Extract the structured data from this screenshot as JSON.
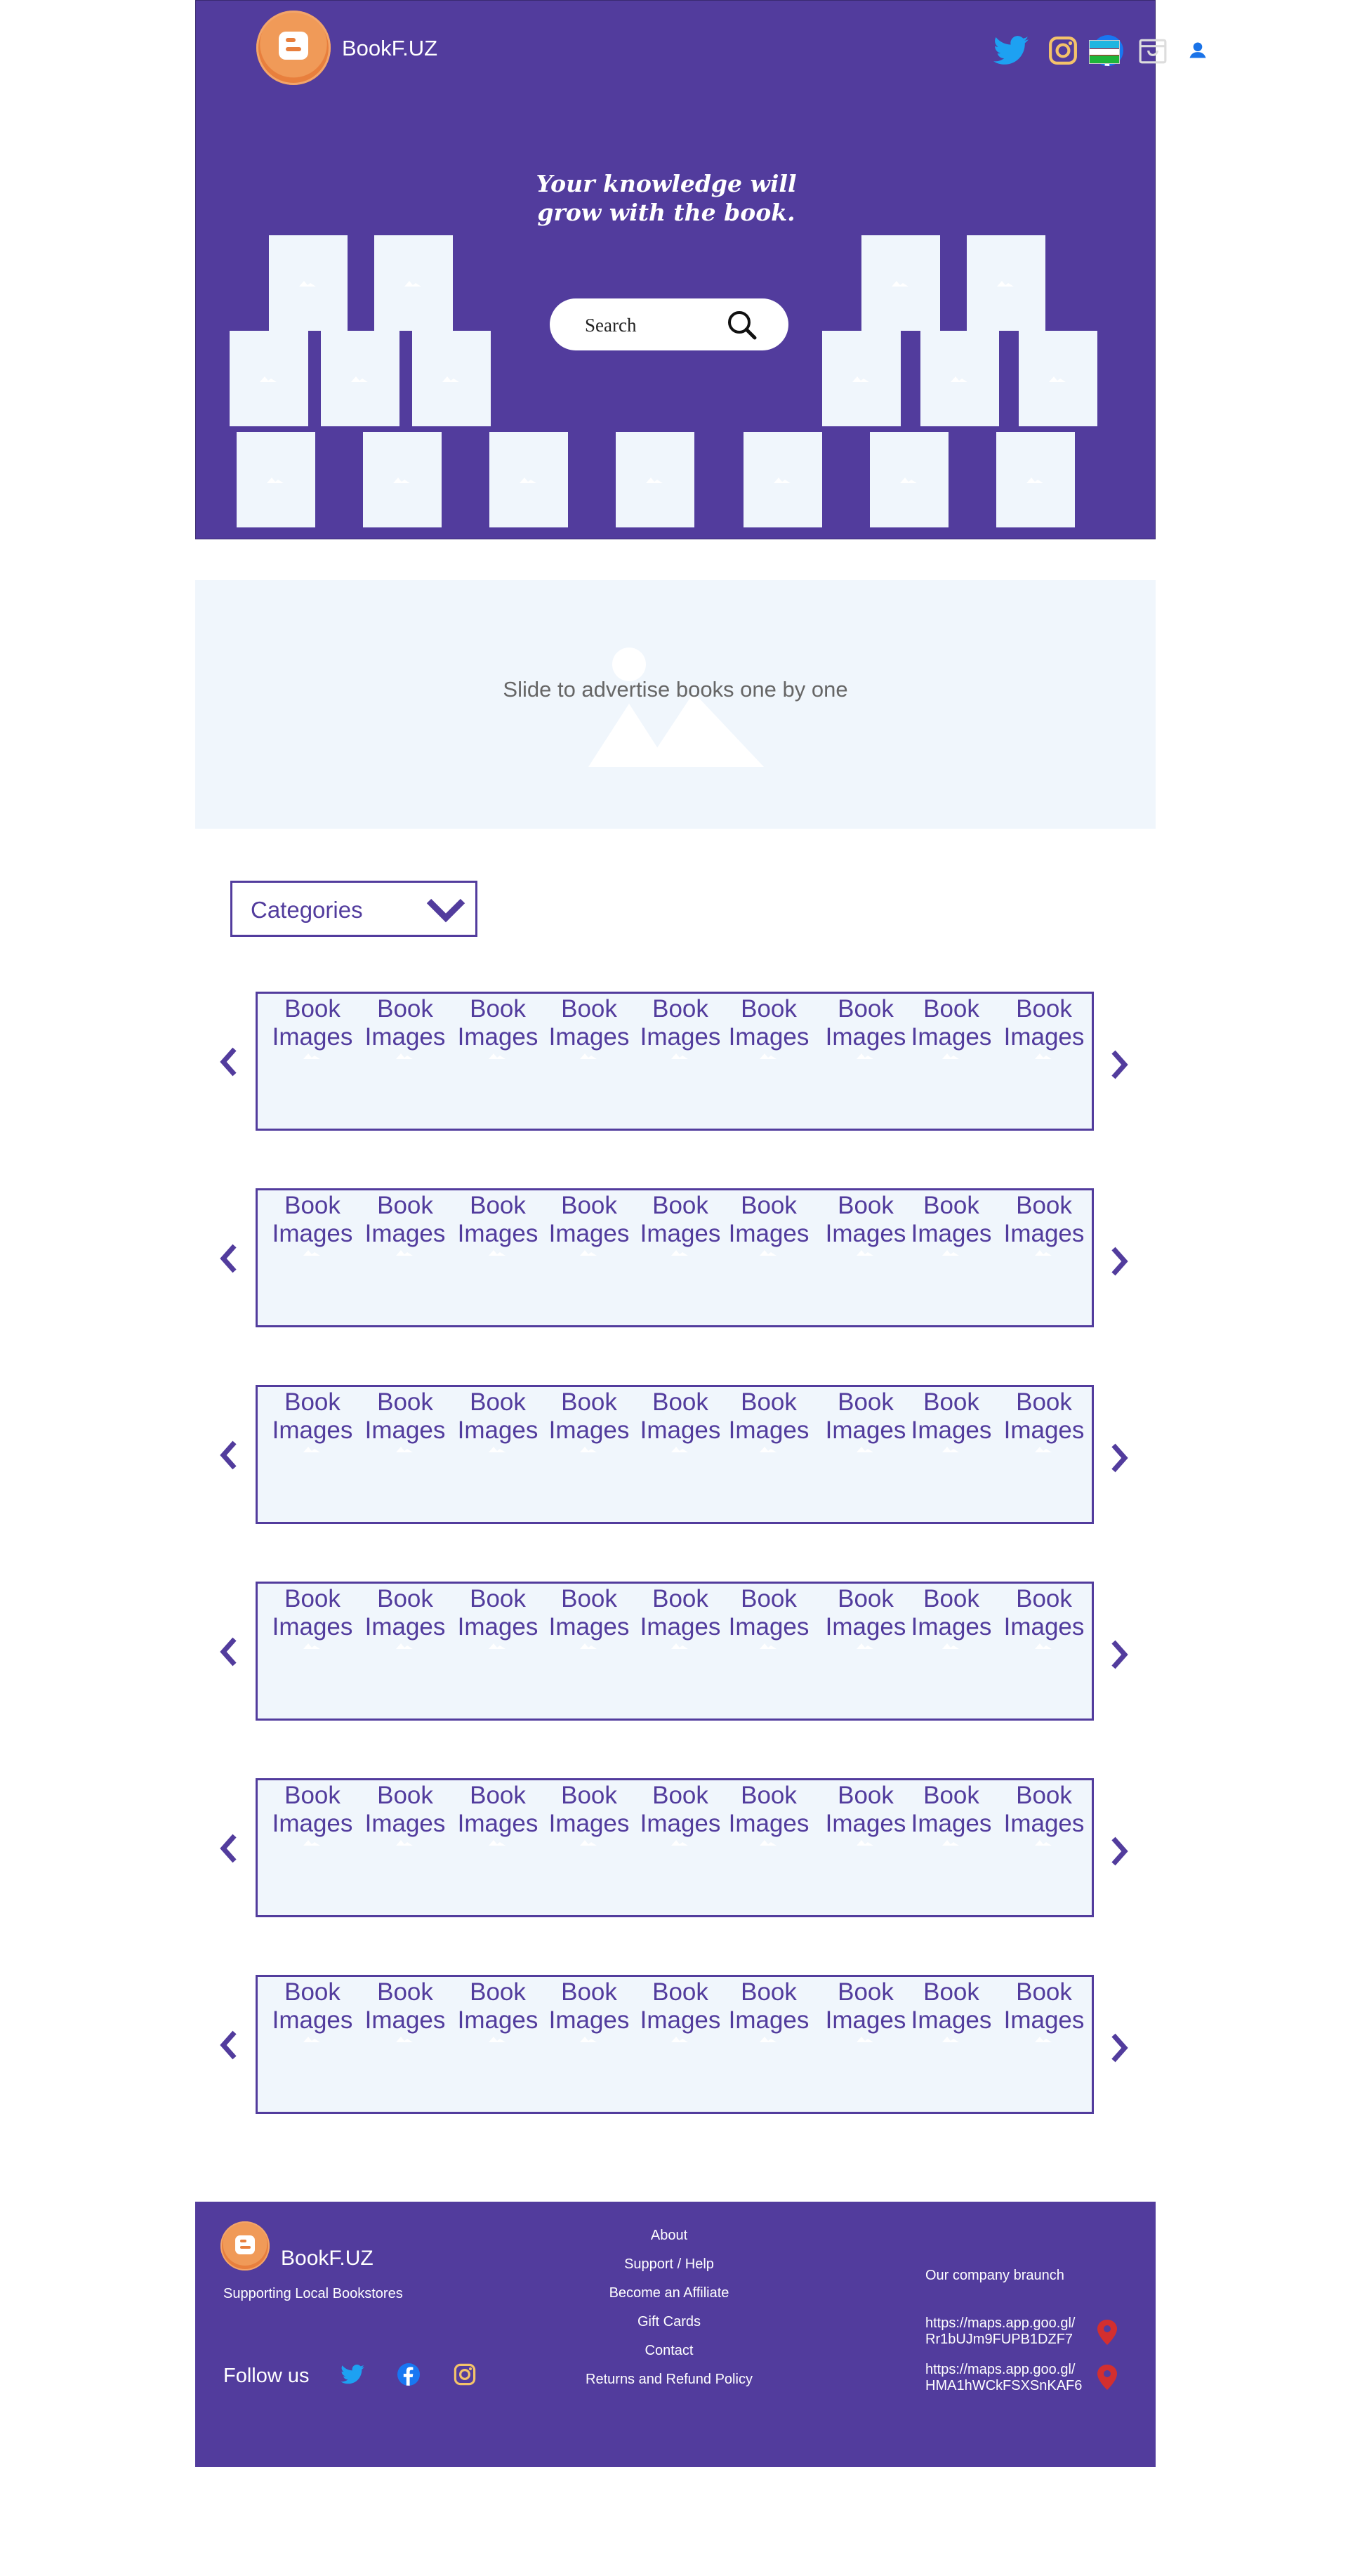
{
  "header": {
    "brand": "BookF.UZ",
    "slogan": "Your knowledge will grow with the book.",
    "search_placeholder": "Search",
    "social_icons": [
      "twitter-icon",
      "instagram-icon",
      "facebook-icon",
      "shop-icon",
      "user-icon"
    ],
    "flag_colors": [
      "#1eb5e0",
      "#ffffff",
      "#1eb53a"
    ]
  },
  "slider": {
    "text": "Slide to advertise books one by one"
  },
  "categories": {
    "label": "Categories"
  },
  "book_rows": [
    [
      "Book Images",
      "Book Images",
      "Book Images",
      "Book Images",
      "Book Images",
      "Book Images",
      "Book Images",
      "Book Images",
      "Book Images"
    ],
    [
      "Book Images",
      "Book Images",
      "Book Images",
      "Book Images",
      "Book Images",
      "Book Images",
      "Book Images",
      "Book Images",
      "Book Images"
    ],
    [
      "Book Images",
      "Book Images",
      "Book Images",
      "Book Images",
      "Book Images",
      "Book Images",
      "Book Images",
      "Book Images",
      "Book Images"
    ],
    [
      "Book Images",
      "Book Images",
      "Book Images",
      "Book Images",
      "Book Images",
      "Book Images",
      "Book Images",
      "Book Images",
      "Book Images"
    ],
    [
      "Book Images",
      "Book Images",
      "Book Images",
      "Book Images",
      "Book Images",
      "Book Images",
      "Book Images",
      "Book Images",
      "Book Images"
    ],
    [
      "Book Images",
      "Book Images",
      "Book Images",
      "Book Images",
      "Book Images",
      "Book Images",
      "Book Images",
      "Book Images",
      "Book Images"
    ]
  ],
  "footer": {
    "brand": "BookF.UZ",
    "tagline": "Supporting Local Bookstores",
    "follow_label": "Follow us",
    "links": [
      "About",
      "Support / Help",
      "Become an Affiliate",
      "Gift Cards",
      "Contact",
      "Returns and Refund Policy"
    ],
    "branch_title": "Our company braunch",
    "maps": [
      {
        "line1": "https://maps.app.goo.gl/",
        "line2": "Rr1bUJm9FUPB1DZF7"
      },
      {
        "line1": "https://maps.app.goo.gl/",
        "line2": "HMA1hWCkFSXSnKAF6"
      }
    ]
  },
  "colors": {
    "brand_purple": "#523c9d",
    "light_panel": "#f0f6fc",
    "logo_orange": "#e87f3d",
    "pin_red": "#d32f2f"
  }
}
